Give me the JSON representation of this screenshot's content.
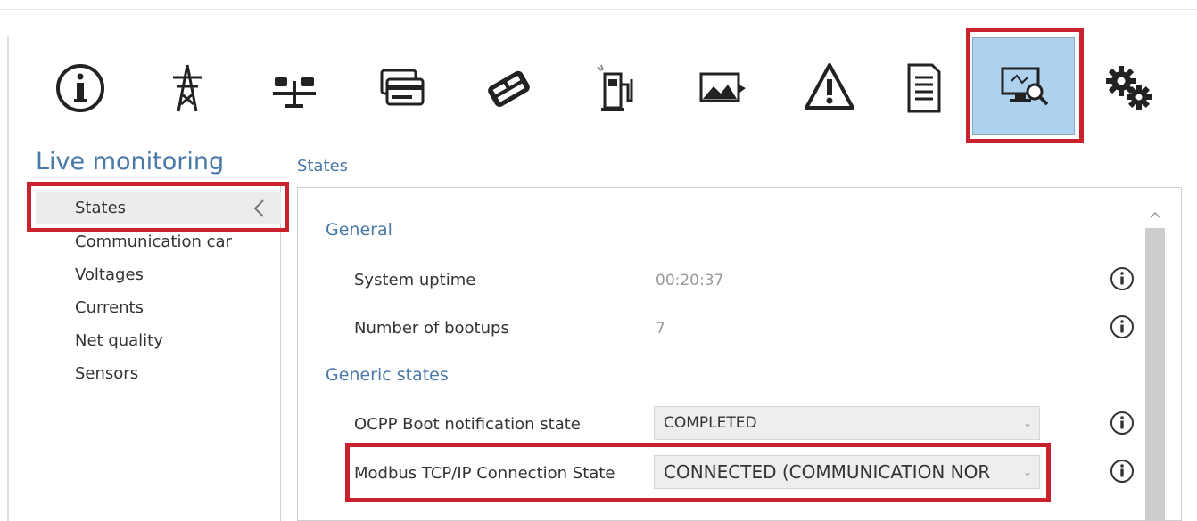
{
  "toolbar": {
    "icons": [
      "info-icon",
      "power-tower-icon",
      "load-balance-icon",
      "payment-card-icon",
      "card-reader-icon",
      "charging-station-icon",
      "image-icon",
      "warning-icon",
      "document-icon",
      "monitor-search-icon",
      "settings-gears-icon"
    ],
    "active_icon": "monitor-search-icon"
  },
  "section_title": "Live monitoring",
  "breadcrumb": "States",
  "nav": {
    "items": [
      "States",
      "Communication car",
      "Voltages",
      "Currents",
      "Net quality",
      "Sensors"
    ],
    "selected": "States"
  },
  "panel": {
    "general": {
      "title": "General",
      "rows": [
        {
          "label": "System uptime",
          "value": "00:20:37"
        },
        {
          "label": "Number of bootups",
          "value": "7"
        }
      ]
    },
    "generic_states": {
      "title": "Generic states",
      "rows": [
        {
          "label": "OCPP Boot notification state",
          "value": "COMPLETED"
        },
        {
          "label": "Modbus TCP/IP Connection State",
          "value": "CONNECTED (COMMUNICATION NOR"
        }
      ]
    }
  },
  "colors": {
    "accent": "#4a79a8",
    "highlight_red": "#c8232c",
    "active_tile": "#aed1ee"
  }
}
